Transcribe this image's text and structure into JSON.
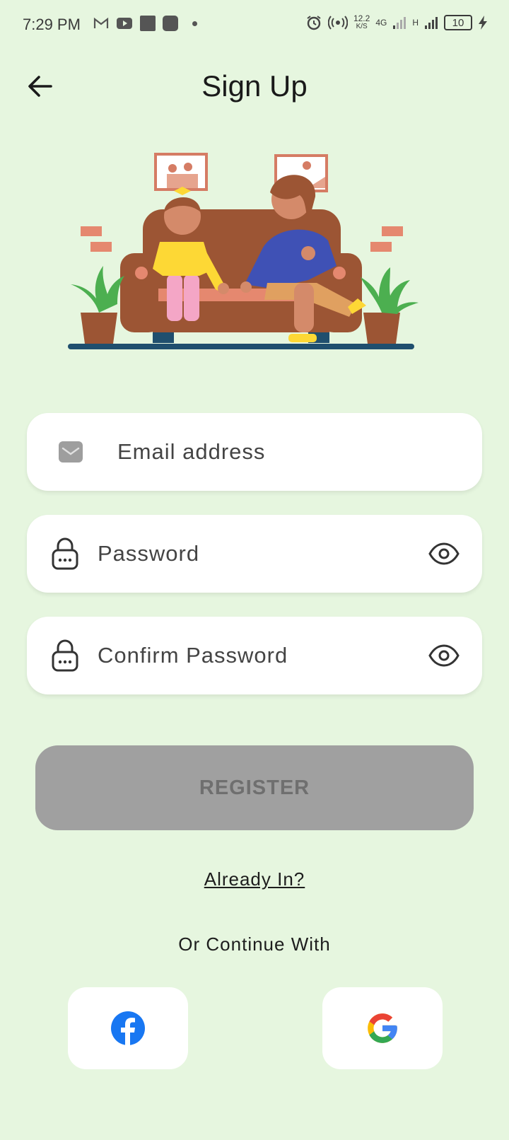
{
  "status_bar": {
    "time": "7:29 PM",
    "speed_value": "12.2",
    "speed_unit": "K/S",
    "network": "4G",
    "network_h": "H",
    "battery": "10"
  },
  "header": {
    "title": "Sign Up"
  },
  "form": {
    "email_placeholder": "Email address",
    "password_placeholder": "Password",
    "confirm_placeholder": "Confirm Password",
    "register_label": "REGISTER"
  },
  "links": {
    "already_in": "Already In?",
    "or_continue": "Or Continue With"
  },
  "social": [
    {
      "name": "facebook",
      "color": "#1877f2"
    },
    {
      "name": "google",
      "colors": [
        "#4285f4",
        "#ea4335",
        "#fbbc05",
        "#34a853"
      ]
    }
  ],
  "colors": {
    "background": "#e6f6df",
    "register_bg": "#a0a0a0",
    "register_text": "#6f6f6f"
  }
}
